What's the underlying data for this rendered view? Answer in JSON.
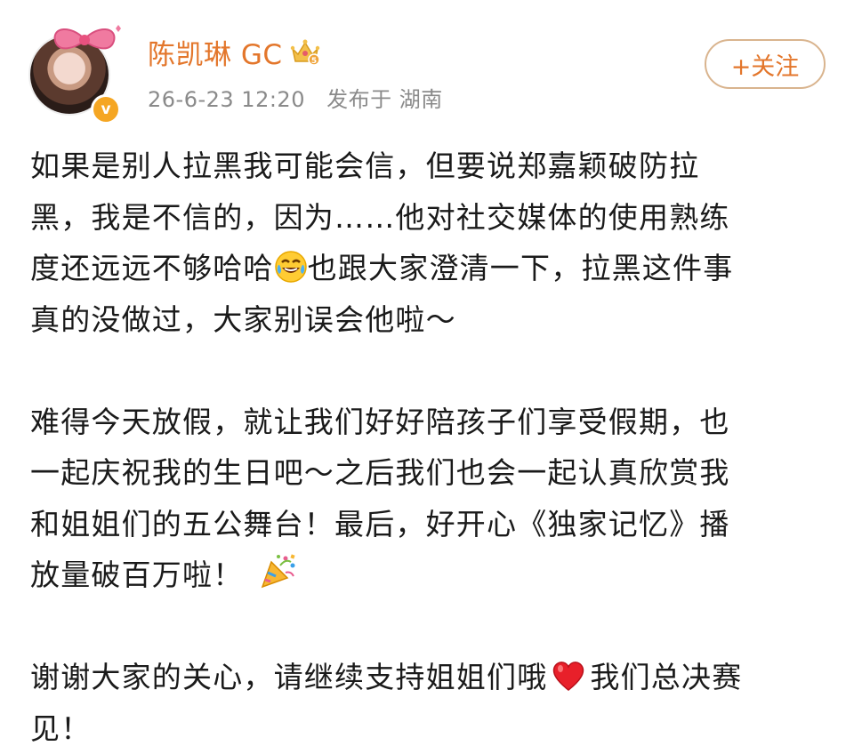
{
  "post": {
    "author": {
      "name": "陈凯琳 GC",
      "level": "5"
    },
    "meta": {
      "timestamp": "26-6-23 12:20",
      "location": "发布于 湖南"
    },
    "follow_label": "+关注",
    "paragraphs": [
      {
        "lines": [
          [
            "如果是别人拉黑我可能会信，但要说郑嘉颖破防拉"
          ],
          [
            "黑，我是不信的，因为……他对社交媒体的使用熟练"
          ],
          [
            "度还远远不够哈哈",
            "也跟大家澄清一下，拉黑这件事"
          ],
          [
            "真的没做过，大家别误会他啦～"
          ]
        ]
      },
      {
        "lines": [
          [
            "难得今天放假，就让我们好好陪孩子们享受假期，也"
          ],
          [
            "一起庆祝我的生日吧～之后我们也会一起认真欣赏我"
          ],
          [
            "和姐姐们的五公舞台！最后，好开心《独家记忆》播"
          ],
          [
            "放量破百万啦！"
          ]
        ]
      },
      {
        "lines": [
          [
            "谢谢大家的关心，请继续支持姐姐们哦",
            "我们总决赛"
          ],
          [
            "见！"
          ]
        ]
      }
    ],
    "emojis": {
      "laugh": "laughing-with-tears-emoji",
      "party": "party-popper-emoji",
      "heart": "red-heart-emoji"
    },
    "colors": {
      "username": "#e3762b",
      "meta_text": "#8a8a8a",
      "follow_border": "#d9b48e",
      "verified_badge": "#f5a623",
      "body_text": "#1a1a1a"
    }
  }
}
